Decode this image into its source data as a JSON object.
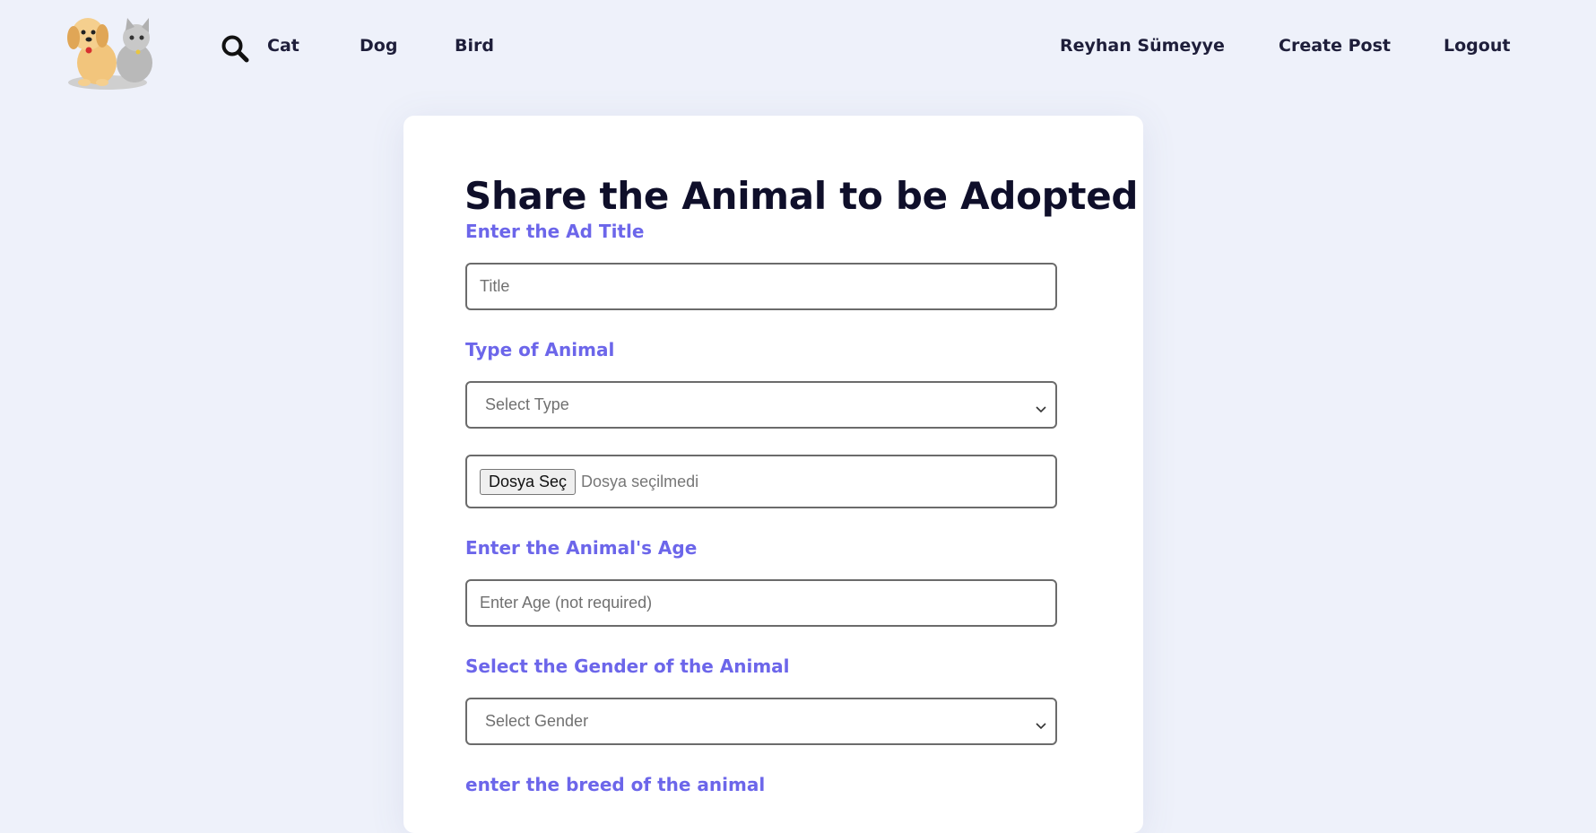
{
  "nav": {
    "logo_icon": "dog-and-cat-logo",
    "search_icon": "search-icon",
    "links": [
      "Cat",
      "Dog",
      "Bird"
    ],
    "user_name": "Reyhan Sümeyye",
    "create_post": "Create Post",
    "logout": "Logout"
  },
  "form": {
    "title": "Share the Animal to be Adopted",
    "ad_title_label": "Enter the Ad Title",
    "ad_title_placeholder": "Title",
    "type_label": "Type of Animal",
    "type_selected": "Select Type",
    "file_button": "Dosya Seç",
    "file_status": "Dosya seçilmedi",
    "age_label": "Enter the Animal's Age",
    "age_placeholder": "Enter Age (not required)",
    "gender_label": "Select the Gender of the Animal",
    "gender_selected": "Select Gender",
    "breed_label": "enter the breed of the animal"
  },
  "colors": {
    "background": "#eef1fa",
    "card": "#ffffff",
    "accent_label": "#6c66ea",
    "heading": "#0f0f2a"
  }
}
